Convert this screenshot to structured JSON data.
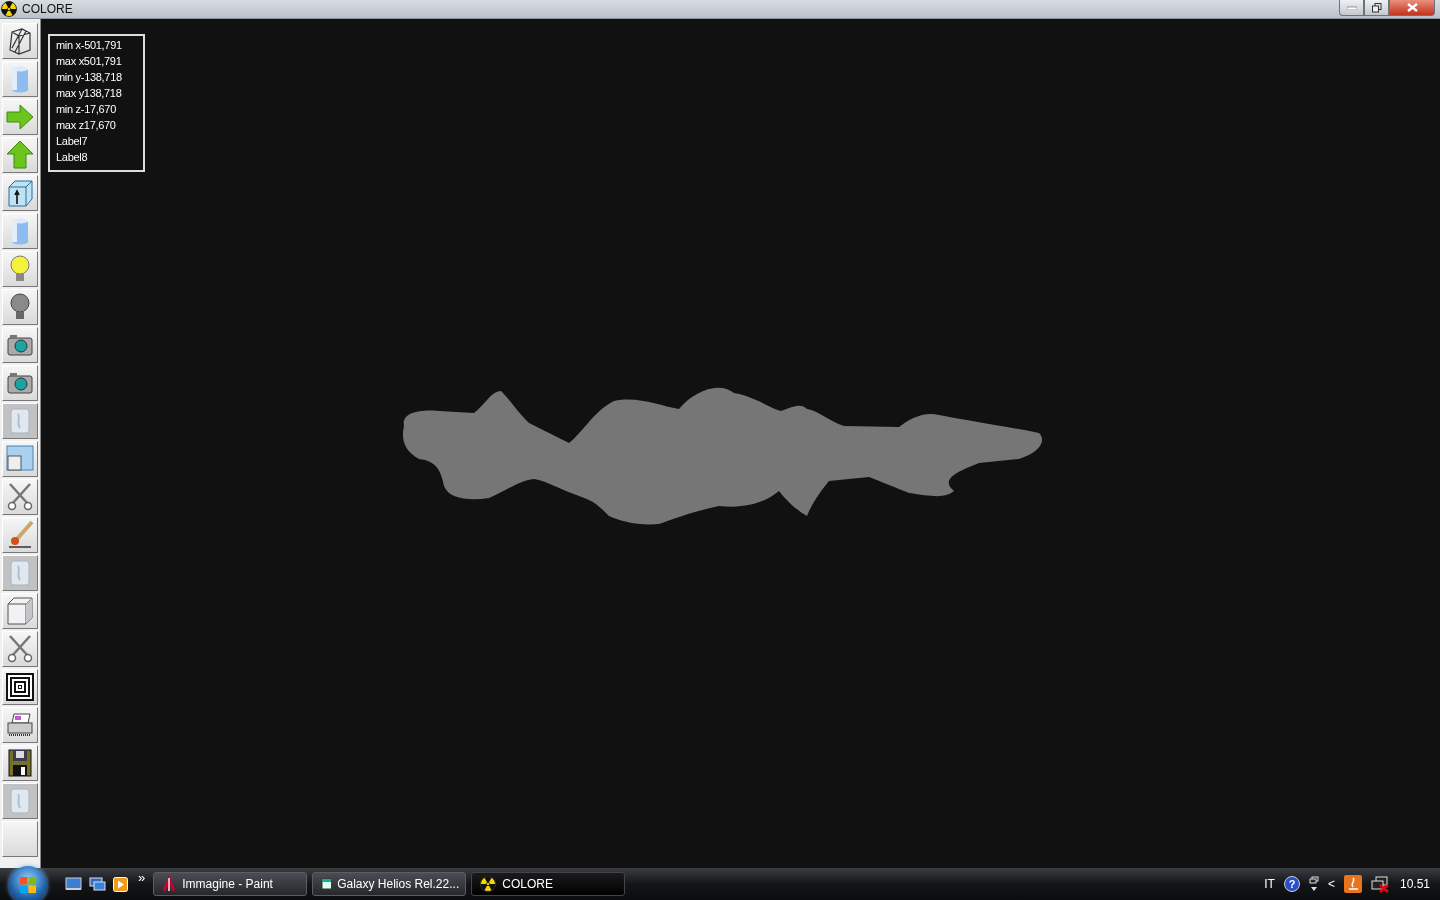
{
  "window": {
    "title": "COLORE"
  },
  "toolbar": [
    {
      "kind": "wireframe",
      "disabled": false
    },
    {
      "kind": "cylinder",
      "disabled": false
    },
    {
      "kind": "right",
      "disabled": false
    },
    {
      "kind": "up",
      "disabled": false
    },
    {
      "kind": "boxarrow",
      "disabled": false
    },
    {
      "kind": "cylinder",
      "disabled": false
    },
    {
      "kind": "bulbon",
      "disabled": false
    },
    {
      "kind": "bulboff",
      "disabled": false
    },
    {
      "kind": "camera",
      "disabled": false
    },
    {
      "kind": "camera",
      "disabled": false
    },
    {
      "kind": "glass",
      "disabled": true
    },
    {
      "kind": "window",
      "disabled": false
    },
    {
      "kind": "scissors",
      "disabled": false
    },
    {
      "kind": "brush",
      "disabled": false
    },
    {
      "kind": "glass",
      "disabled": true
    },
    {
      "kind": "cube",
      "disabled": false
    },
    {
      "kind": "scissors",
      "disabled": false
    },
    {
      "kind": "squares",
      "disabled": false
    },
    {
      "kind": "printer",
      "disabled": false
    },
    {
      "kind": "floppy",
      "disabled": false
    },
    {
      "kind": "glass",
      "disabled": true
    },
    {
      "kind": "empty",
      "disabled": false
    }
  ],
  "info_box": {
    "lines": [
      "min x-501,791",
      "max x501,791",
      "min y-138,718",
      "max y138,718",
      "min z-17,670",
      "max z17,670",
      "Label7",
      "Label8"
    ]
  },
  "taskbar": {
    "quick_launch_more": "»",
    "tasks": [
      {
        "kind": "paint",
        "label": "Immagine - Paint",
        "selected": false
      },
      {
        "kind": "galaxy",
        "label": "Galaxy Helios  Rel.22...",
        "selected": false
      },
      {
        "kind": "colore",
        "label": "COLORE",
        "selected": true
      }
    ],
    "language": "IT",
    "help_mark": "?",
    "tray_arrow": "<",
    "clock": "10.51"
  }
}
